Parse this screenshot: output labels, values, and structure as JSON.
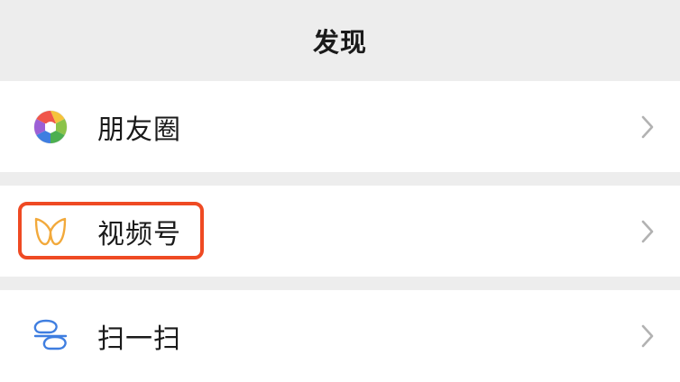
{
  "header": {
    "title": "发现"
  },
  "items": [
    {
      "label": "朋友圈",
      "icon": "moments-aperture-icon"
    },
    {
      "label": "视频号",
      "icon": "channels-butterfly-icon"
    },
    {
      "label": "扫一扫",
      "icon": "scan-icon"
    }
  ],
  "colors": {
    "background": "#ededed",
    "row_background": "#ffffff",
    "highlight_border": "#ef4a23",
    "channels_icon": "#f2a93b",
    "scan_icon": "#3f7ee0",
    "chevron": "#b2b2b2"
  }
}
